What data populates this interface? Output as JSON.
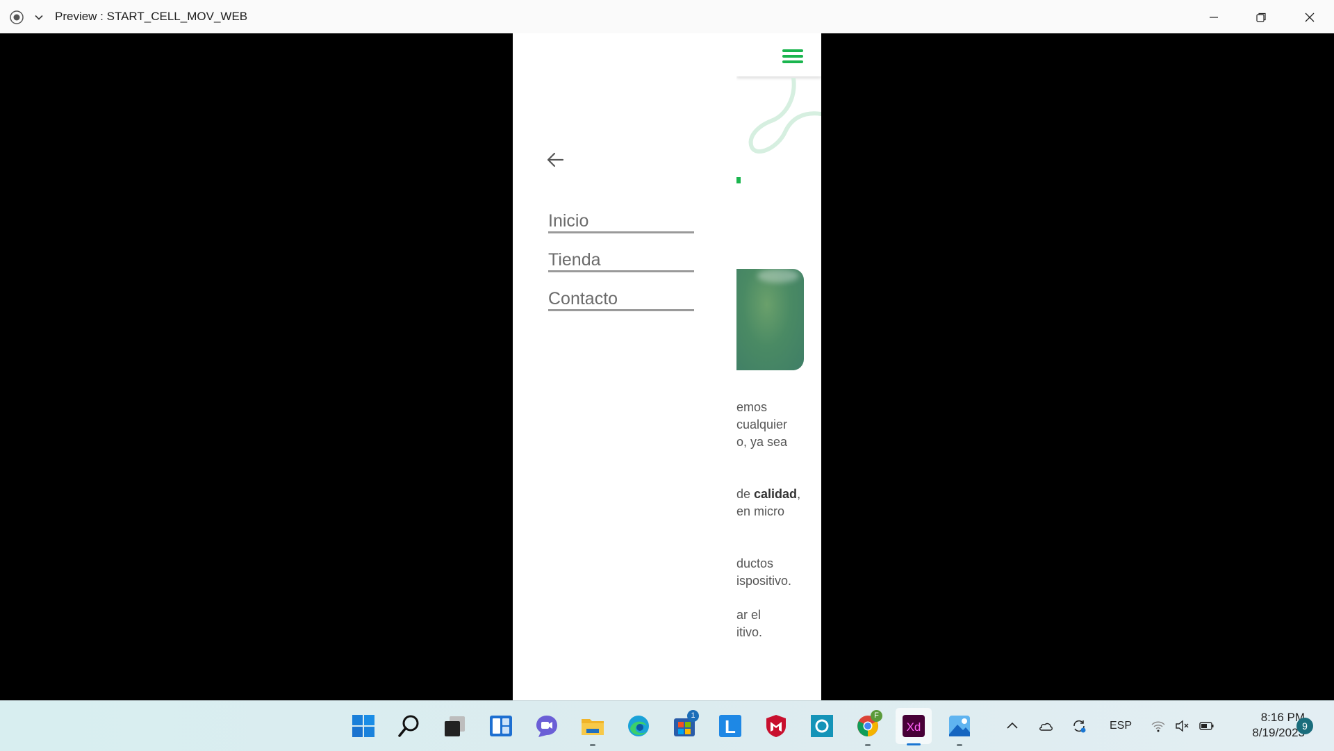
{
  "window": {
    "title": "Preview : START_CELL_MOV_WEB",
    "icons": [
      "record-icon",
      "chevron-down-icon",
      "minimize-icon",
      "restore-icon",
      "close-icon"
    ]
  },
  "app": {
    "menu": {
      "back_icon": "arrow-left-icon",
      "items": [
        {
          "label": "Inicio"
        },
        {
          "label": "Tienda"
        },
        {
          "label": "Contacto"
        }
      ]
    },
    "header": {
      "menu_icon": "hamburger-icon",
      "accent": "#1ab54e"
    },
    "content": {
      "para1": [
        "emos",
        "cualquier",
        "o, ya sea"
      ],
      "para2_prefix": "de ",
      "para2_bold": "calidad",
      "para2_suffix": ",",
      "para2_line2": "en micro",
      "para3": [
        "ductos",
        "ispositivo."
      ],
      "para4": [
        "ar el",
        "itivo."
      ]
    }
  },
  "taskbar": {
    "apps": [
      "windows-start-icon",
      "search-icon",
      "task-view-icon",
      "widgets-icon",
      "teams-chat-icon",
      "file-explorer-icon",
      "edge-icon",
      "microsoft-store-icon",
      "l-app-icon",
      "mcafee-icon",
      "cortana-icon",
      "chrome-icon",
      "adobe-xd-icon",
      "photos-icon"
    ],
    "store_badge": "1",
    "chrome_badge": "F",
    "xd_label": "Xd",
    "l_label": "L",
    "tray_icons": [
      "chevron-up-icon",
      "onedrive-icon",
      "sync-icon",
      "wifi-icon",
      "mute-icon",
      "battery-icon"
    ],
    "language": "ESP",
    "time": "8:16 PM",
    "date": "8/19/2023",
    "notifications": "9"
  }
}
